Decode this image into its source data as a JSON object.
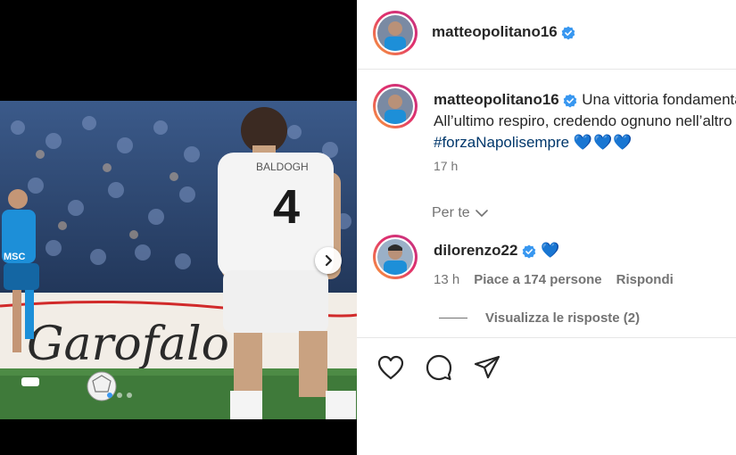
{
  "post": {
    "author": "matteopolitano16",
    "caption_line1": "Una vittoria fondamentale",
    "caption_line2": "All’ultimo respiro, credendo ognuno nell’altro",
    "hashtag": "#forzaNapolisempre",
    "caption_hearts": "💙💙💙",
    "time": "17 h"
  },
  "sort_label": "Per te",
  "comment": {
    "author": "dilorenzo22",
    "text": "💙",
    "time": "13 h",
    "likes_label": "Piace a 174 persone",
    "reply_label": "Rispondi",
    "view_replies_label": "Visualizza le risposte (2)"
  },
  "photo": {
    "player_number": "4",
    "shirt_name": "BALDOGH",
    "billboard_text": "Garofalo"
  },
  "icons": {
    "verified": "verified-badge-icon",
    "like": "heart-icon",
    "comment": "comment-icon",
    "share": "send-icon",
    "next": "chevron-right-icon",
    "sort": "chevron-down-icon"
  },
  "colors": {
    "verified_blue": "#3897f0",
    "hashtag": "#00376b",
    "napoli_blue": "#1d8fd8"
  }
}
